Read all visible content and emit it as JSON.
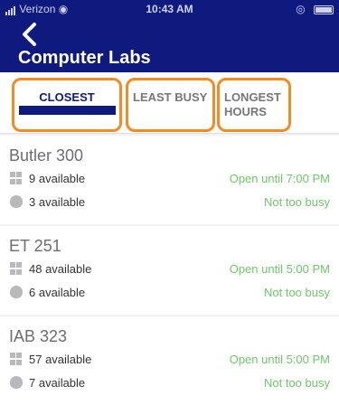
{
  "status_bar": {
    "carrier": "Verizon",
    "time": "10:43 AM"
  },
  "header": {
    "title": "Computer Labs"
  },
  "tabs": [
    {
      "label": "CLOSEST",
      "selected": true
    },
    {
      "label": "LEAST BUSY",
      "selected": false
    },
    {
      "label": "LONGEST HOURS",
      "selected": false
    }
  ],
  "labs": [
    {
      "name": "Butler 300",
      "windows": "9 available",
      "windows_status": "Open until 7:00 PM",
      "mac": "3 available",
      "mac_status": "Not too busy"
    },
    {
      "name": "ET 251",
      "windows": "48 available",
      "windows_status": "Open until 5:00 PM",
      "mac": "6 available",
      "mac_status": "Not too busy"
    },
    {
      "name": "IAB 323",
      "windows": "57 available",
      "windows_status": "Open until 5:00 PM",
      "mac": "7 available",
      "mac_status": "Not too busy"
    }
  ],
  "colors": {
    "header": "#0f1a7e",
    "accent": "#f58a22",
    "status_green": "#6dc867"
  },
  "icons": [
    "back-chevron-icon",
    "windows-icon",
    "apple-icon",
    "wifi-icon",
    "battery-icon"
  ]
}
